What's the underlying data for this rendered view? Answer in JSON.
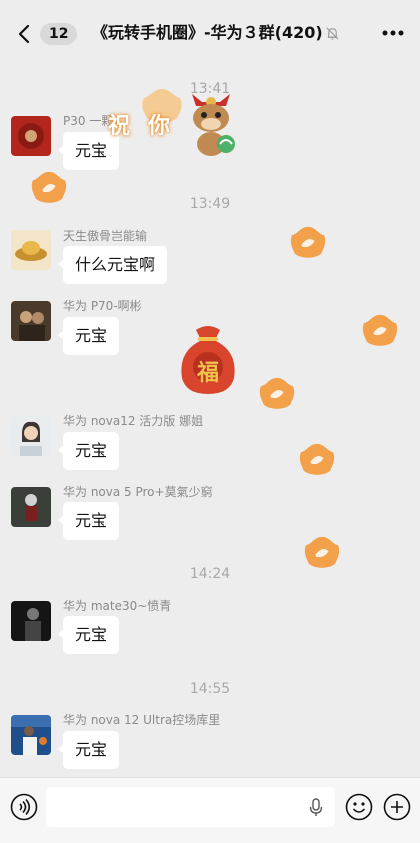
{
  "header": {
    "back_badge": "12",
    "title": "《玩转手机圈》-华为３群(420)"
  },
  "timestamps": [
    "13:41",
    "13:49",
    "14:24",
    "14:55"
  ],
  "messages": [
    {
      "sender": "P30 一颗…",
      "text": "元宝"
    },
    {
      "sender": "天生傲骨岂能输",
      "text": "什么元宝啊"
    },
    {
      "sender": "华为 P70-啊彬",
      "text": "元宝"
    },
    {
      "sender": "华为 nova12 活力版  娜姐",
      "text": "元宝"
    },
    {
      "sender": "华为 nova 5 Pro+莫氣少窮",
      "text": "元宝"
    },
    {
      "sender": "华为 mate30~愤青",
      "text": "元宝"
    },
    {
      "sender": "华为 nova 12 Ultra控场库里",
      "text": "元宝"
    }
  ],
  "stickers": {
    "bless_chars": [
      "祝",
      "你"
    ],
    "fu_char": "福"
  },
  "colors": {
    "background": "#ededed",
    "bubble": "#ffffff",
    "yuanbao": "#f2a04a",
    "fu_bag": "#d8442c"
  },
  "icons": {
    "back": "chevron-left-icon",
    "mute": "bell-off-icon",
    "more": "more-icon",
    "voice": "voice-icon",
    "mic": "mic-icon",
    "emoji": "emoji-icon",
    "plus": "plus-icon"
  }
}
